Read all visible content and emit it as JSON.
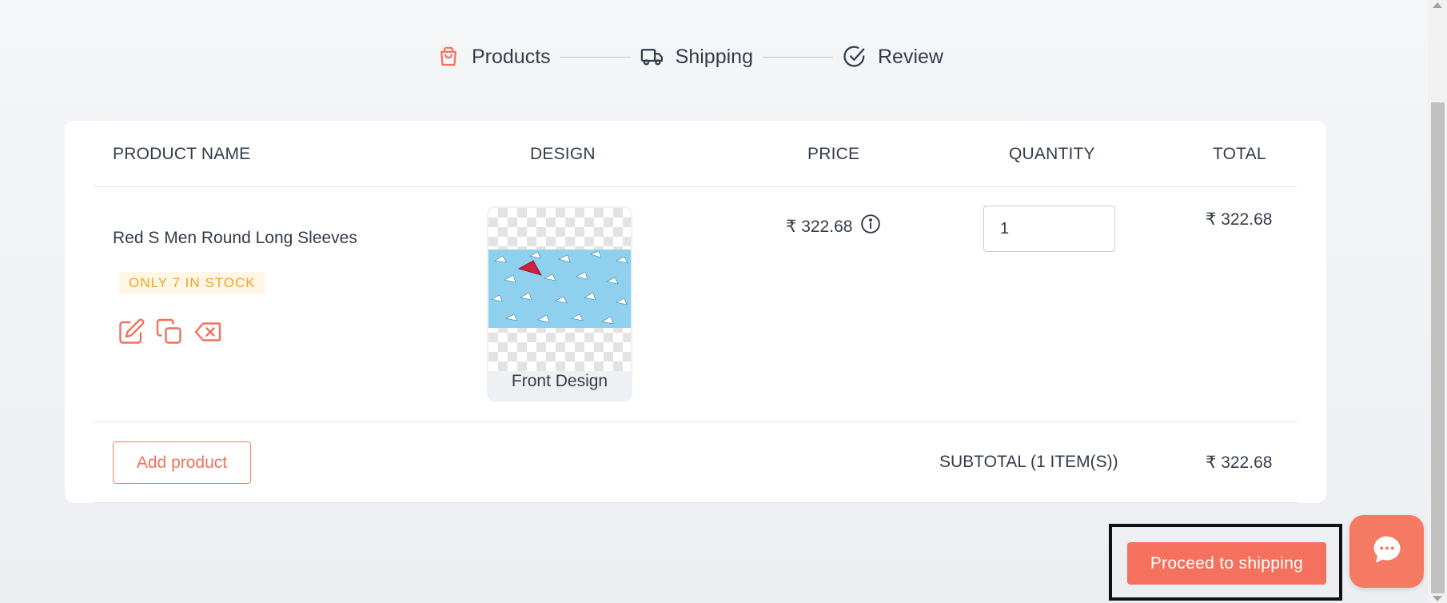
{
  "stepper": {
    "steps": [
      {
        "label": "Products",
        "icon": "shopping-bag-icon",
        "active": true
      },
      {
        "label": "Shipping",
        "icon": "truck-icon",
        "active": false
      },
      {
        "label": "Review",
        "icon": "check-circle-icon",
        "active": false
      }
    ]
  },
  "table": {
    "headers": {
      "product_name": "PRODUCT NAME",
      "design": "DESIGN",
      "price": "PRICE",
      "quantity": "QUANTITY",
      "total": "TOTAL"
    },
    "rows": [
      {
        "product_name": "Red S Men Round Long Sleeves",
        "stock_badge": "ONLY 7 IN STOCK",
        "design_label": "Front Design",
        "price": "₹ 322.68",
        "quantity": "1",
        "total": "₹ 322.68",
        "actions": [
          "edit-icon",
          "duplicate-icon",
          "delete-icon"
        ]
      }
    ]
  },
  "footer": {
    "add_product": "Add product",
    "subtotal_label": "SUBTOTAL (1 ITEM(S))",
    "subtotal_value": "₹ 322.68"
  },
  "proceed_button": "Proceed to shipping",
  "chat_icon": "chat-bubble-icon",
  "colors": {
    "accent": "#f4715d",
    "stock_text": "#f0a326",
    "stock_bg": "#fff6e5",
    "text": "#333c4a",
    "background": "#eef0f3"
  }
}
